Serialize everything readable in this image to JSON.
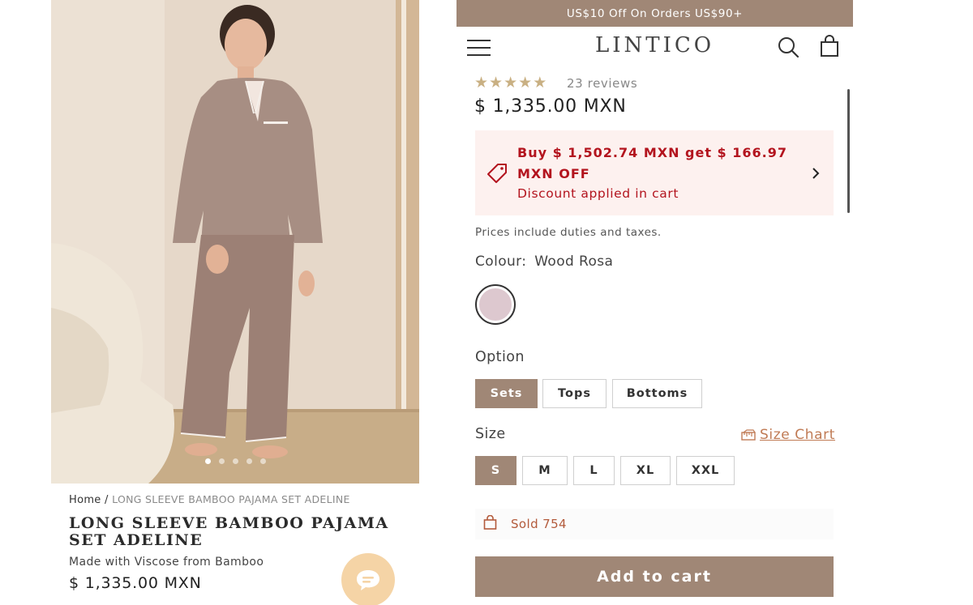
{
  "announcement": {
    "text": "US$10 Off On Orders US$90+"
  },
  "header": {
    "brand": "LINTICO",
    "menu_icon": "hamburger-menu-icon",
    "search_icon": "search-icon",
    "cart_icon": "shopping-bag-icon"
  },
  "gallery": {
    "image_alt": "Model wearing long sleeve bamboo pajama set",
    "slide_count": 5,
    "active_slide": 1
  },
  "breadcrumb": {
    "home": "Home",
    "separator": "/",
    "current": "LONG SLEEVE BAMBOO PAJAMA SET ADELINE"
  },
  "product": {
    "title": "LONG SLEEVE BAMBOO PAJAMA SET ADELINE",
    "subtitle": "Made with Viscose from Bamboo",
    "price": "$ 1,335.00 MXN",
    "rating": 5,
    "reviews": "23 reviews",
    "tax_note": "Prices include duties and taxes."
  },
  "promo": {
    "title": "Buy $ 1,502.74 MXN get $ 166.97 MXN OFF",
    "subtitle": "Discount applied in cart",
    "color": "#b3141e",
    "icon": "tag-icon"
  },
  "colour": {
    "label": "Colour:",
    "value": "Wood Rosa",
    "swatch_color": "#ddc8cf"
  },
  "option": {
    "label": "Option",
    "choices": [
      "Sets",
      "Tops",
      "Bottoms"
    ],
    "selected": "Sets"
  },
  "size": {
    "label": "Size",
    "chart_label": "Size Chart",
    "choices": [
      "S",
      "M",
      "L",
      "XL",
      "XXL"
    ],
    "selected": "S"
  },
  "sold": {
    "text": "Sold 754"
  },
  "cta": {
    "add_to_cart": "Add to cart"
  },
  "colors": {
    "accent": "#a08776",
    "promo_bg": "#fdf1ef",
    "size_chart": "#c07b55",
    "chat_bubble": "#f5d4a6",
    "star": "#c9b083"
  }
}
